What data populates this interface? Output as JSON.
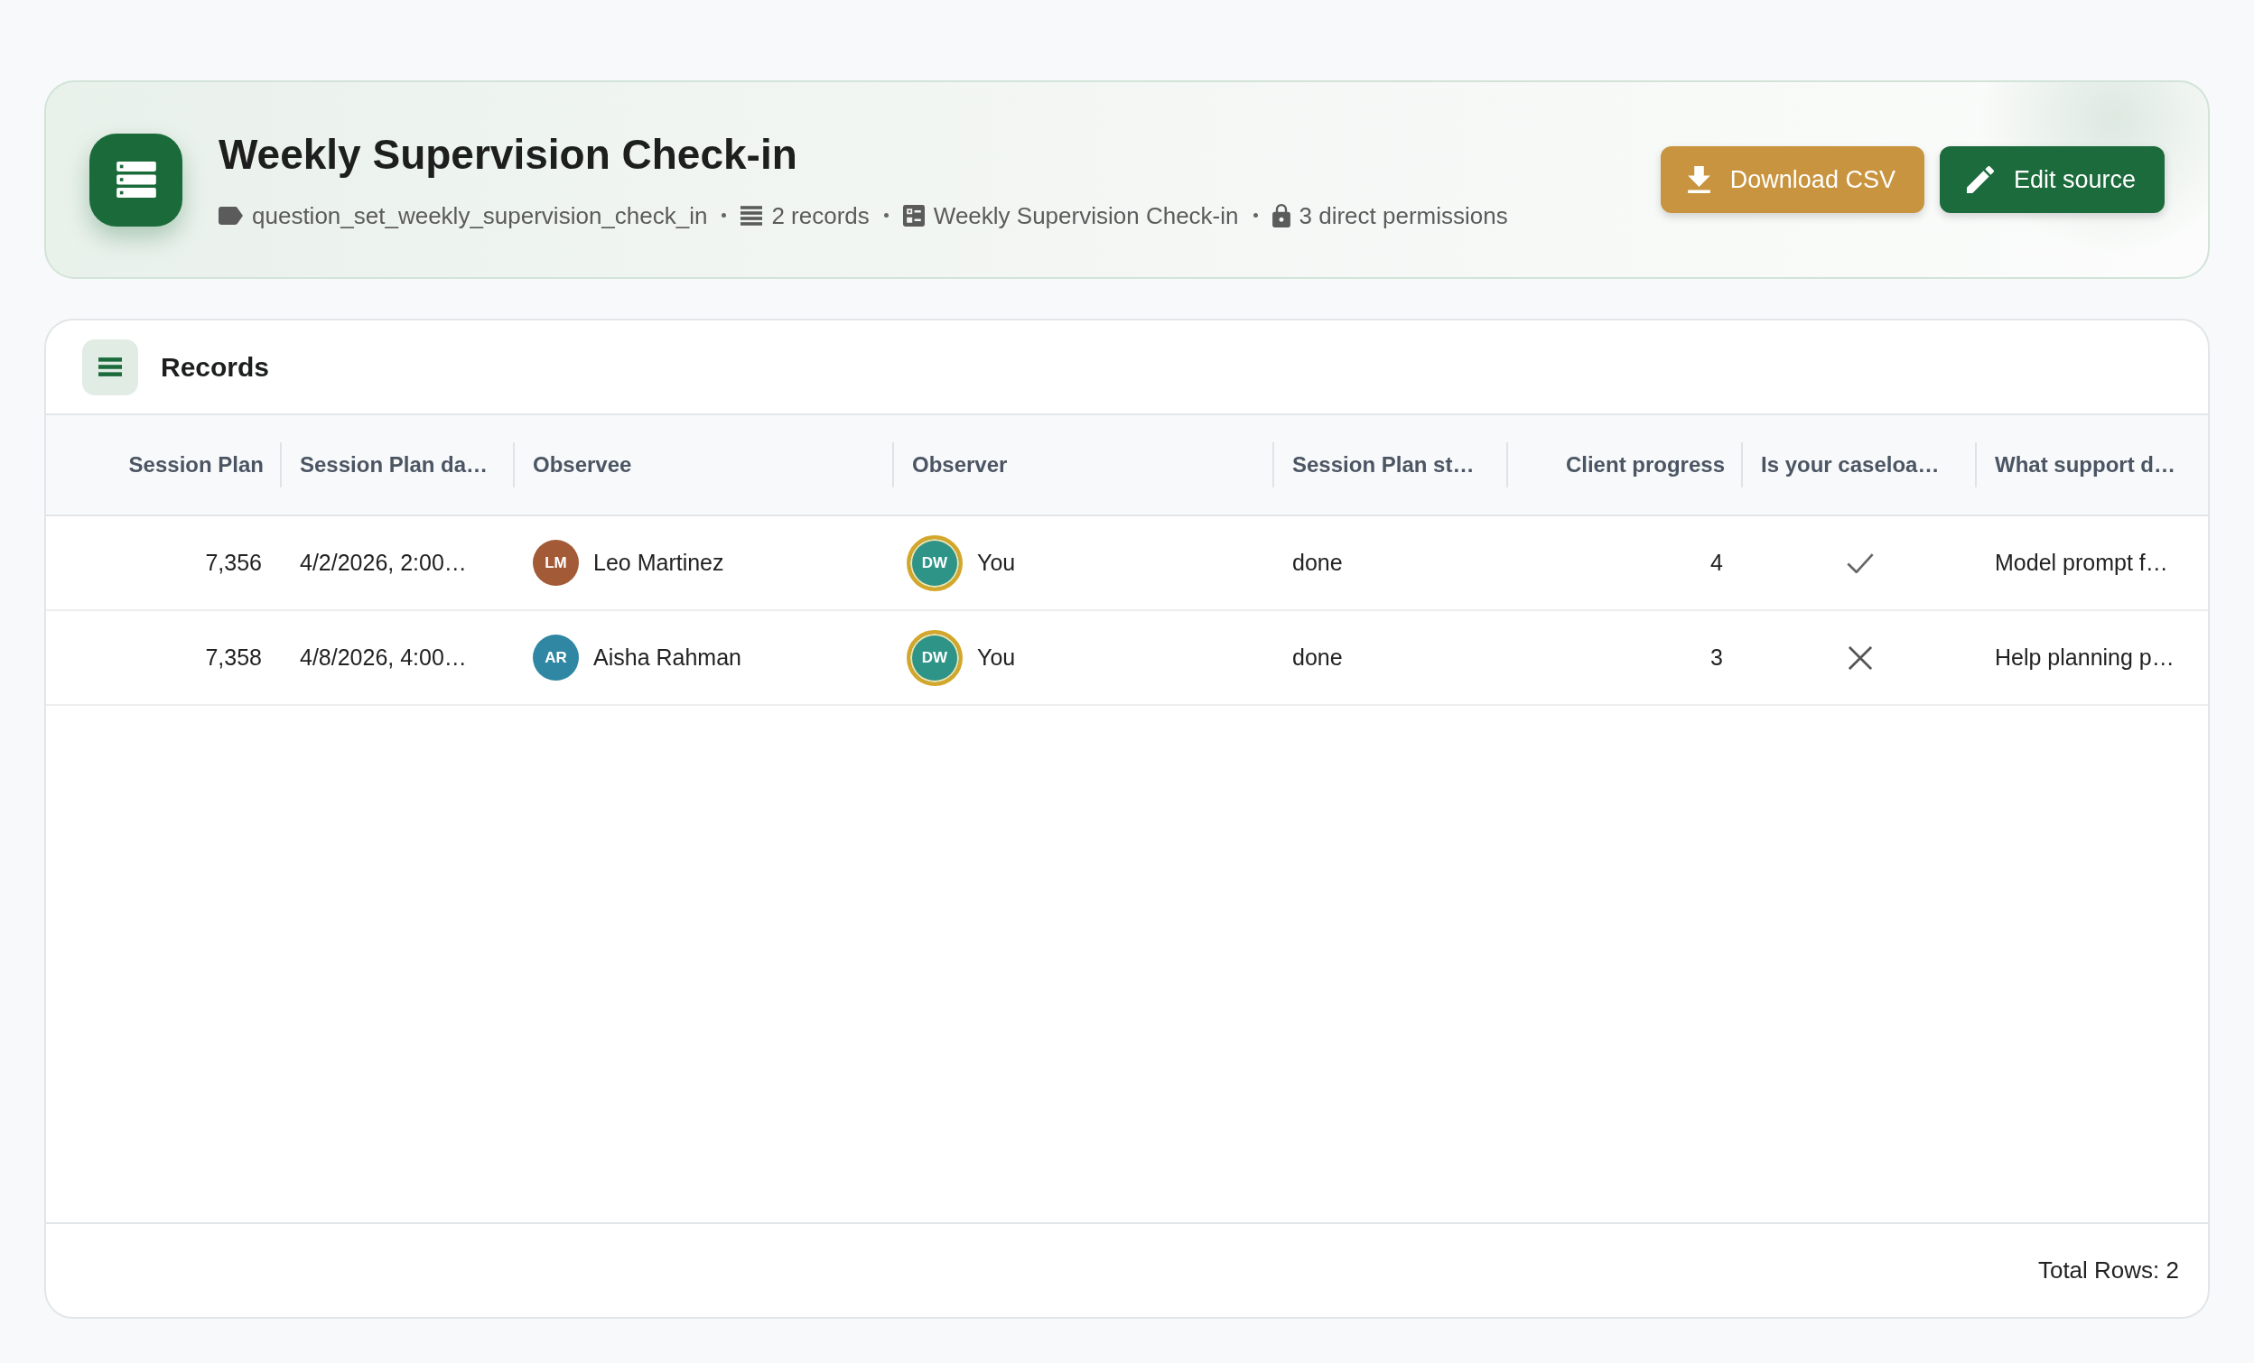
{
  "header": {
    "title": "Weekly Supervision Check-in",
    "meta": [
      {
        "kind": "tag",
        "text": "question_set_weekly_supervision_check_in"
      },
      {
        "kind": "records",
        "text": "2 records"
      },
      {
        "kind": "form",
        "text": "Weekly Supervision Check-in"
      },
      {
        "kind": "lock",
        "text": "3 direct permissions"
      }
    ],
    "actions": [
      {
        "kind": "download",
        "label": "Download CSV"
      },
      {
        "kind": "edit",
        "label": "Edit source"
      }
    ]
  },
  "records": {
    "title": "Records",
    "columns": [
      {
        "label": "Session Plan",
        "kind": "number"
      },
      {
        "label": "Session Plan da…",
        "kind": "text"
      },
      {
        "label": "Observee",
        "kind": "person"
      },
      {
        "label": "Observer",
        "kind": "person"
      },
      {
        "label": "Session Plan st…",
        "kind": "text"
      },
      {
        "label": "Client progress",
        "kind": "number"
      },
      {
        "label": "Is your caseloa…",
        "kind": "boolean"
      },
      {
        "label": "What support d…",
        "kind": "text"
      }
    ],
    "rows": [
      {
        "cells": [
          "7,356",
          "4/2/2026, 2:00…",
          {
            "initials": "LM",
            "name": "Leo Martinez",
            "color": "#a35a37",
            "current_user": false
          },
          {
            "initials": "DW",
            "name": "You",
            "color": "#2f9488",
            "current_user": true
          },
          "done",
          "4",
          {
            "checked": true
          },
          "Model prompt f…"
        ]
      },
      {
        "cells": [
          "7,358",
          "4/8/2026, 4:00…",
          {
            "initials": "AR",
            "name": "Aisha Rahman",
            "color": "#2f87a3",
            "current_user": false
          },
          {
            "initials": "DW",
            "name": "You",
            "color": "#2f9488",
            "current_user": true
          },
          "done",
          "3",
          {
            "checked": false
          },
          "Help planning p…"
        ]
      }
    ],
    "footer": "Total Rows: 2"
  }
}
